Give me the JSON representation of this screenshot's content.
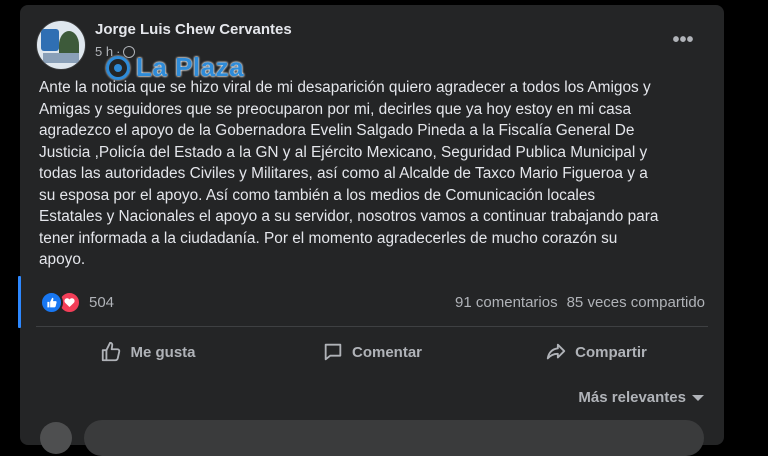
{
  "post": {
    "author": "Jorge Luis Chew Cervantes",
    "timestamp": "5 h",
    "more_label": "•••",
    "text": "Ante la noticia que se hizo viral de mi desaparición quiero agradecer a todos los Amigos y\nAmigas y seguidores que se preocuparon por mi, decirles que ya hoy estoy en mi casa\nagradezco el apoyo de la Gobernadora Evelin Salgado Pineda a la Fiscalía General De\nJusticia ,Policía del Estado a la GN y al Ejército Mexicano, Seguridad Publica Municipal y\ntodas las autoridades Civiles y Militares, así como al Alcalde de Taxco Mario Figueroa y a\nsu esposa  por el apoyo. Así como también a los medios de Comunicación locales\nEstatales y Nacionales el apoyo a su servidor, nosotros vamos a continuar trabajando para\ntener informada a la ciudadanía. Por el momento agradecerles de mucho corazón su\napoyo."
  },
  "watermark": {
    "text": "La Plaza"
  },
  "reactions": {
    "count": "504",
    "icons": [
      "like-icon",
      "love-icon"
    ]
  },
  "stats": {
    "comments": "91 comentarios",
    "shares": "85 veces compartido"
  },
  "actions": {
    "like": "Me gusta",
    "comment": "Comentar",
    "share": "Compartir"
  },
  "comments_sort": {
    "label": "Más relevantes"
  },
  "colors": {
    "background": "#242526",
    "text": "#e4e6eb",
    "secondary_text": "#b0b3b8",
    "accent": "#1877f2",
    "love": "#f33e58"
  }
}
